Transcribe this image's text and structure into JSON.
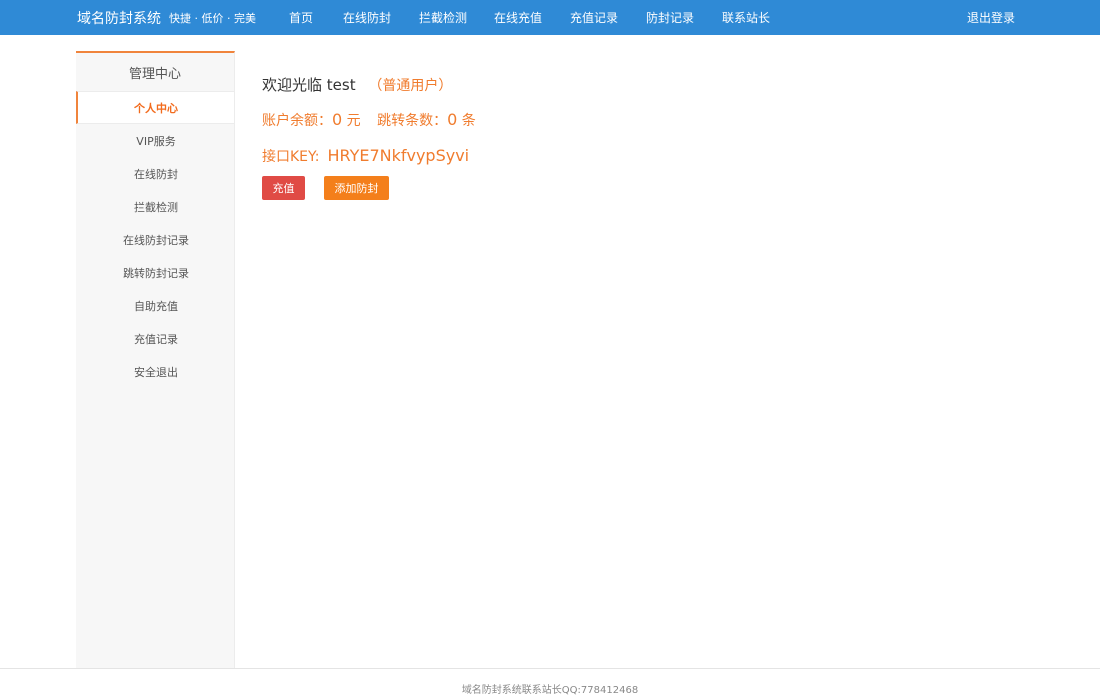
{
  "header": {
    "brand_name": "域名防封系统",
    "brand_slogan": "快捷 · 低价 · 完美",
    "nav": [
      {
        "label": "首页"
      },
      {
        "label": "在线防封"
      },
      {
        "label": "拦截检测"
      },
      {
        "label": "在线充值"
      },
      {
        "label": "充值记录"
      },
      {
        "label": "防封记录"
      },
      {
        "label": "联系站长"
      }
    ],
    "logout": "退出登录"
  },
  "sidebar": {
    "title": "管理中心",
    "items": [
      {
        "label": "个人中心"
      },
      {
        "label": "VIP服务"
      },
      {
        "label": "在线防封"
      },
      {
        "label": "拦截检测"
      },
      {
        "label": "在线防封记录"
      },
      {
        "label": "跳转防封记录"
      },
      {
        "label": "自助充值"
      },
      {
        "label": "充值记录"
      },
      {
        "label": "安全退出"
      }
    ],
    "active_index": 0
  },
  "main": {
    "welcome_prefix": "欢迎光临",
    "username": "test",
    "user_type": "（普通用户）",
    "balance_label": "账户余额：",
    "balance_value": "0",
    "balance_unit": "元",
    "jump_label": "跳转条数：",
    "jump_value": "0",
    "jump_unit": "条",
    "key_label": "接口KEY:",
    "key_value": "HRYE7NkfvypSyvi",
    "recharge_button": "充值",
    "add_button": "添加防封"
  },
  "footer": {
    "text": "域名防封系统联系站长QQ:778412468"
  },
  "colors": {
    "topbar": "#2f8ad6",
    "accent": "#f07c2e",
    "recharge_button": "#e04b45",
    "add_button": "#f47f1b"
  }
}
